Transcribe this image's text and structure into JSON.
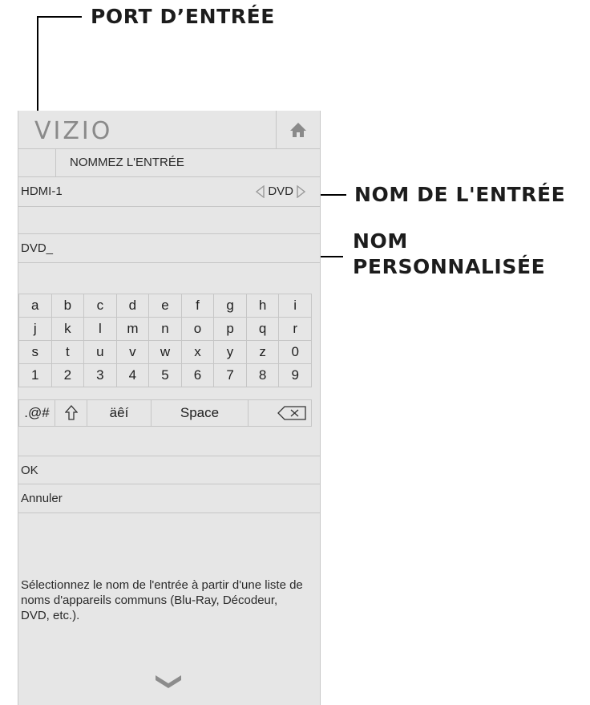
{
  "callouts": {
    "input_port": "PORT D’ENTRÉE",
    "input_name": "NOM DE L'ENTRÉE",
    "custom_name_line1": "NOM",
    "custom_name_line2": "PERSONNALISÉE"
  },
  "header": {
    "logo": "VIZIO",
    "home_icon": "home-icon"
  },
  "screen_title": "NOMMEZ L'ENTRÉE",
  "input": {
    "port": "HDMI-1",
    "name": "DVD"
  },
  "custom_name": {
    "value": "DVD_"
  },
  "keyboard": {
    "rows": [
      [
        "a",
        "b",
        "c",
        "d",
        "e",
        "f",
        "g",
        "h",
        "i"
      ],
      [
        "j",
        "k",
        "l",
        "m",
        "n",
        "o",
        "p",
        "q",
        "r"
      ],
      [
        "s",
        "t",
        "u",
        "v",
        "w",
        "x",
        "y",
        "z",
        "0"
      ],
      [
        "1",
        "2",
        "3",
        "4",
        "5",
        "6",
        "7",
        "8",
        "9"
      ]
    ],
    "symbols": ".@#",
    "shift_icon": "shift-arrow-icon",
    "accents": "äêí",
    "space": "Space",
    "backspace_icon": "backspace-icon"
  },
  "menu": {
    "ok": "OK",
    "cancel": "Annuler"
  },
  "help_text": "Sélectionnez le nom de l'entrée à partir d'une liste de noms d'appareils communs (Blu-Ray, Décodeur, DVD, etc.).",
  "footer_icon": "chevron-down-icon"
}
